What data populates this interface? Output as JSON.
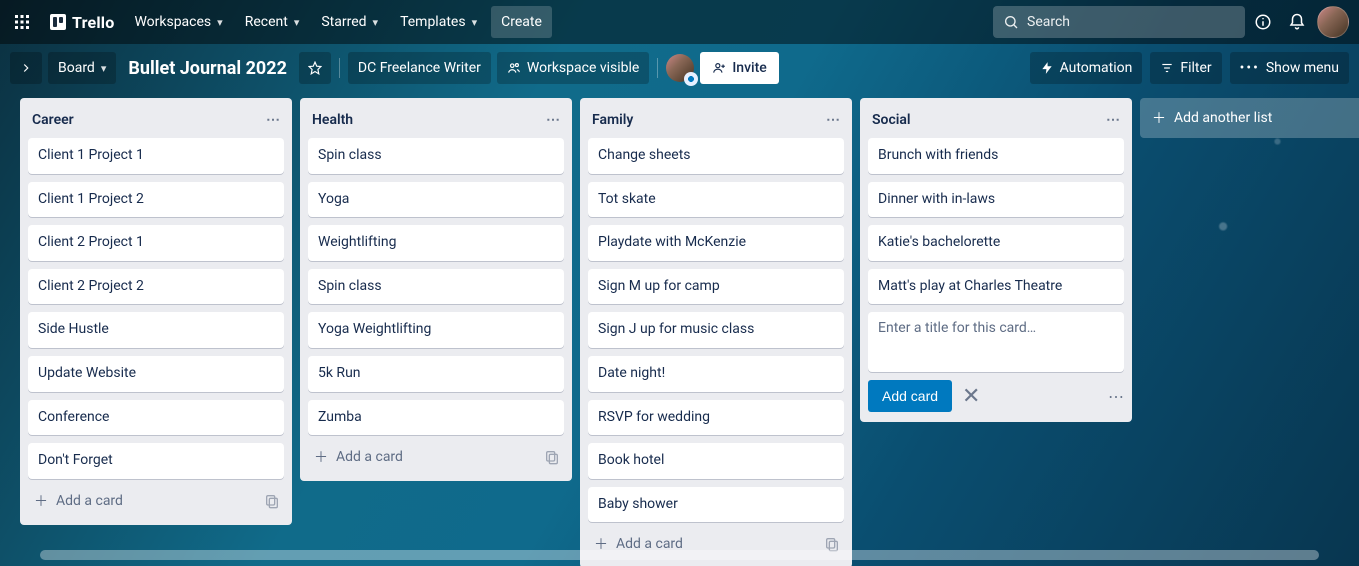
{
  "nav": {
    "workspaces": "Workspaces",
    "recent": "Recent",
    "starred": "Starred",
    "templates": "Templates",
    "create": "Create",
    "search_placeholder": "Search",
    "logo_text": "Trello"
  },
  "board_bar": {
    "board_label": "Board",
    "title": "Bullet Journal 2022",
    "workspace_name": "DC Freelance Writer",
    "visibility": "Workspace visible",
    "invite": "Invite",
    "automation": "Automation",
    "filter": "Filter",
    "show_menu": "Show menu"
  },
  "lists": [
    {
      "title": "Career",
      "cards": [
        "Client 1 Project 1",
        "Client 1 Project 2",
        "Client 2 Project 1",
        "Client 2 Project 2",
        "Side Hustle",
        "Update Website",
        "Conference",
        "Don't Forget"
      ],
      "add_label": "Add a card"
    },
    {
      "title": "Health",
      "cards": [
        "Spin class",
        "Yoga",
        "Weightlifting",
        "Spin class",
        "Yoga Weightlifting",
        "5k Run",
        "Zumba"
      ],
      "add_label": "Add a card"
    },
    {
      "title": "Family",
      "cards": [
        "Change sheets",
        "Tot skate",
        "Playdate with McKenzie",
        "Sign M up for camp",
        "Sign J up for music class",
        "Date night!",
        "RSVP for wedding",
        "Book hotel",
        "Baby shower"
      ],
      "add_label": "Add a card"
    },
    {
      "title": "Social",
      "cards": [
        "Brunch with friends",
        "Dinner with in-laws",
        "Katie's bachelorette",
        "Matt's play at Charles Theatre"
      ],
      "composer_placeholder": "Enter a title for this card…",
      "add_button": "Add card"
    }
  ],
  "add_list_label": "Add another list"
}
